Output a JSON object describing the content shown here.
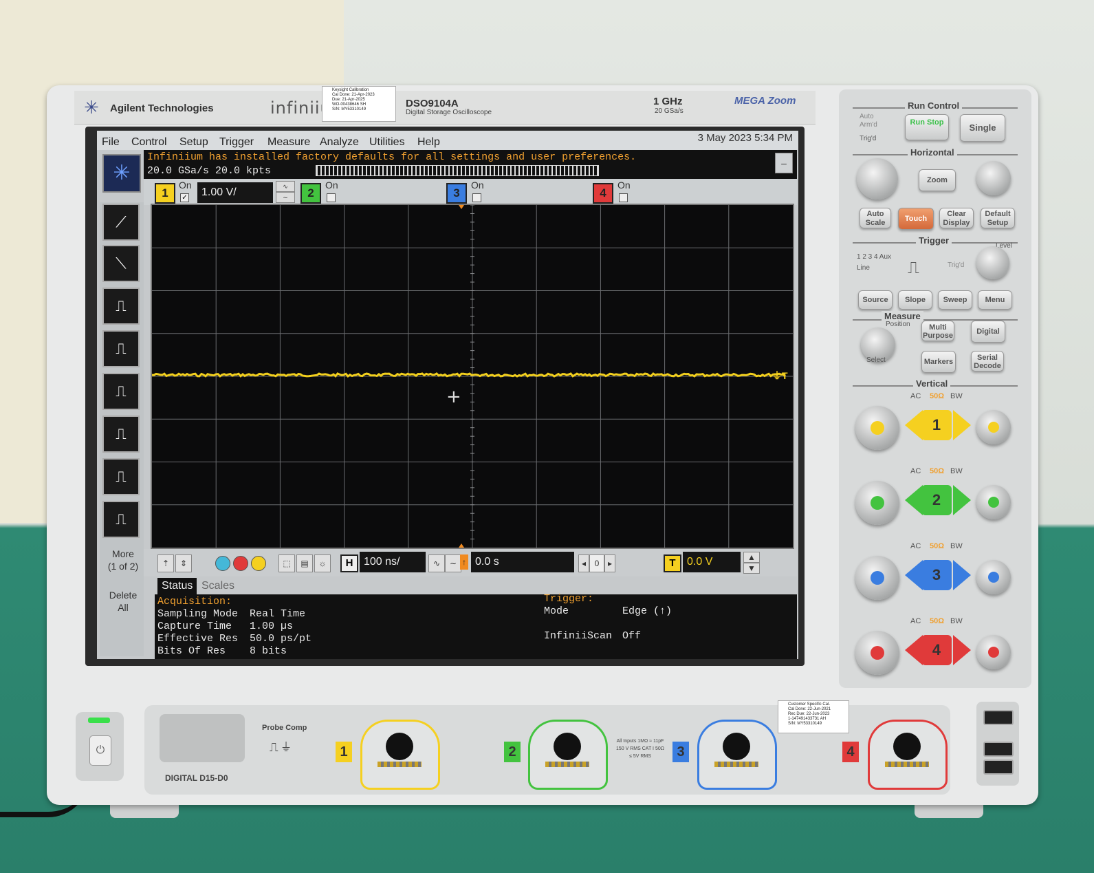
{
  "instrument": {
    "brand": "Agilent Technologies",
    "series": "infiniium",
    "model": "DSO9104A",
    "model_desc": "Digital Storage Oscilloscope",
    "bandwidth": "1 GHz",
    "sample_rate": "20 GSa/s",
    "feature": "MEGA Zoom"
  },
  "cal_sticker": {
    "title": "Keysight Calibration",
    "cal_done": "Cal Done:   21-Apr-2023",
    "due": "Due:        21-Apr-2025",
    "wo": "WO-00438646     SH",
    "sn": "S/N: MY53310149"
  },
  "cal_sticker2": {
    "title": "Customer Specific Cal.",
    "cal_done": "Cal Done:  22-Jun-2021",
    "rec_due": "Rec Due:   22-Jun-2023",
    "ref": "1-147491433731  AH",
    "sn": "S/N: MY53310149"
  },
  "menu": [
    "File",
    "Control",
    "Setup",
    "Trigger",
    "Measure",
    "Analyze",
    "Utilities",
    "Help"
  ],
  "clock": "3 May 2023  5:34 PM",
  "message": "Infiniium has installed factory defaults for all settings and user preferences.",
  "acquisition_line": "20.0 GSa/s  20.0 kpts",
  "channels": [
    {
      "num": "1",
      "on_label": "On",
      "checked": "✓",
      "scale": "1.00 V/",
      "color": "#f5d020"
    },
    {
      "num": "2",
      "on_label": "On",
      "checked": "",
      "color": "#43c33f"
    },
    {
      "num": "3",
      "on_label": "On",
      "checked": "",
      "color": "#3a7de0"
    },
    {
      "num": "4",
      "on_label": "On",
      "checked": "",
      "color": "#e03a3a"
    }
  ],
  "side": {
    "more": "More",
    "more_page": "(1 of 2)",
    "delete": "Delete",
    "delete2": "All"
  },
  "horizontal": {
    "tag": "H",
    "scale": "100 ns/",
    "position": "0.0 s",
    "zoom_val": "0"
  },
  "trigger_ctl": {
    "tag": "T",
    "level": "0.0 V"
  },
  "tabs": {
    "status": "Status",
    "scales": "Scales"
  },
  "status": {
    "acq_title": "Acquisition:",
    "rows": [
      {
        "k": "Sampling Mode",
        "v": "Real Time"
      },
      {
        "k": "Capture Time",
        "v": "1.00 µs"
      },
      {
        "k": "Effective Res",
        "v": "50.0 ps/pt"
      },
      {
        "k": "Bits Of Res",
        "v": "8 bits"
      }
    ],
    "trig_title": "Trigger:",
    "trig_rows": [
      {
        "k": "Mode",
        "v": "Edge (↑)"
      },
      {
        "k": "InfiniiScan",
        "v": "Off"
      }
    ]
  },
  "panel": {
    "run_control": "Run Control",
    "run_stop": "Run Stop",
    "single": "Single",
    "auto_armd": "Auto Arm'd",
    "trigd": "Trig'd",
    "horizontal": "Horizontal",
    "zoom": "Zoom",
    "auto_scale": "Auto Scale",
    "touch": "Touch",
    "clear_display": "Clear Display",
    "default_setup": "Default Setup",
    "trigger": "Trigger",
    "level": "Level",
    "src_list": "1  2  3  4  Aux  Line",
    "source": "Source",
    "slope": "Slope",
    "sweep": "Sweep",
    "menu": "Menu",
    "measure": "Measure",
    "position": "Position",
    "multi_purpose": "Multi Purpose",
    "digital": "Digital",
    "select": "Select",
    "markers": "Markers",
    "serial_decode": "Serial Decode",
    "vertical": "Vertical",
    "ac": "AC",
    "ohm": "50Ω",
    "bwl": "BW"
  },
  "front": {
    "digital": "DIGITAL D15-D0",
    "probe_comp": "Probe Comp",
    "inputs_note": "All Inputs 1MΩ ≈ 11pF 150 V RMS CAT I 50Ω ≤ 5V RMS"
  },
  "waveform": {
    "channel": "1",
    "level_div": 0.0,
    "color": "#f2cf1d"
  }
}
